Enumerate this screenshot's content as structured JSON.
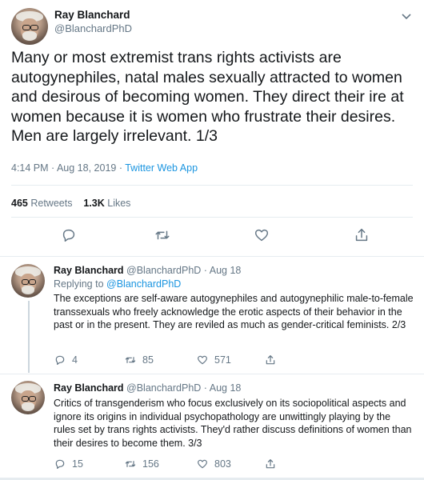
{
  "main_tweet": {
    "author_name": "Ray Blanchard",
    "author_handle": "@BlanchardPhD",
    "text": "Many or most extremist trans rights activists are autogynephiles, natal males sexually attracted to women and desirous of becoming women. They direct their ire at women because it is women who frustrate their desires. Men are largely irrelevant. 1/3",
    "time": "4:14 PM · Aug 18, 2019 · ",
    "source": "Twitter Web App",
    "retweets_count": "465",
    "retweets_label": "Retweets",
    "likes_count": "1.3K",
    "likes_label": "Likes",
    "actions": [
      "reply-icon",
      "retweet-icon",
      "like-icon",
      "share-icon"
    ]
  },
  "replies": [
    {
      "author_name": "Ray Blanchard",
      "author_handle": "@BlanchardPhD · Aug 18",
      "replying_prefix": "Replying to ",
      "replying_to": "@BlanchardPhD",
      "text": "The exceptions are self-aware autogynephiles and autogynephilic male-to-female transsexuals who freely acknowledge the erotic aspects of their behavior in the past or in the present. They are reviled as much as gender-critical feminists. 2/3",
      "reply_count": "4",
      "retweet_count": "85",
      "like_count": "571"
    },
    {
      "author_name": "Ray Blanchard",
      "author_handle": "@BlanchardPhD · Aug 18",
      "text": "Critics of transgenderism who focus exclusively on its sociopolitical aspects and ignore its origins in individual psychopathology are unwittingly playing by the rules set by trans rights activists. They'd rather discuss definitions of women than their desires to become them. 3/3",
      "reply_count": "15",
      "retweet_count": "156",
      "like_count": "803"
    }
  ],
  "colors": {
    "link": "#1b95e0",
    "muted": "#657786",
    "text": "#14171a",
    "border": "#e6ecf0"
  }
}
